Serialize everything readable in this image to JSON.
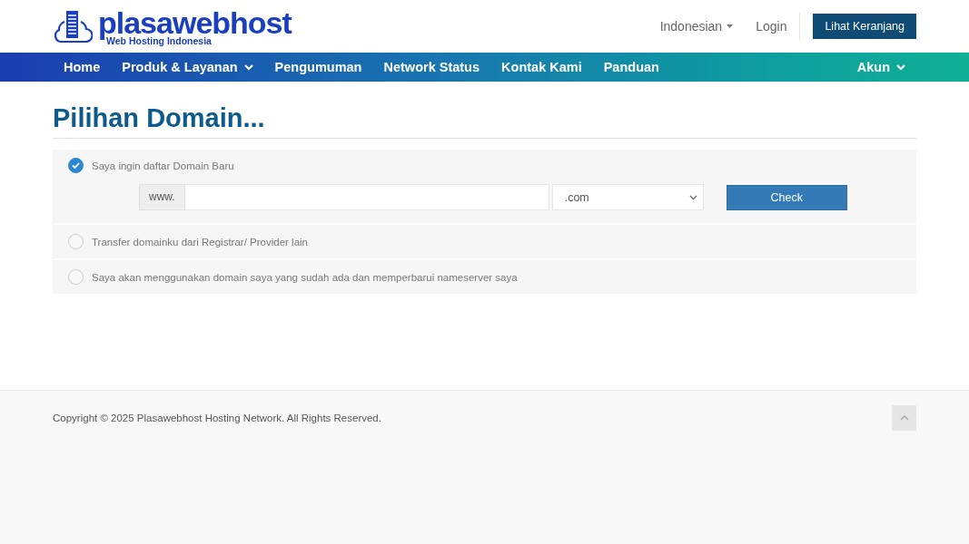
{
  "header": {
    "logo": {
      "name": "plasawebhost",
      "tagline": "Web Hosting Indonesia"
    },
    "language": "Indonesian",
    "login": "Login",
    "cart_button": "Lihat Keranjang"
  },
  "nav": {
    "items": [
      {
        "label": "Home",
        "has_menu": false
      },
      {
        "label": "Produk & Layanan",
        "has_menu": true
      },
      {
        "label": "Pengumuman",
        "has_menu": false
      },
      {
        "label": "Network Status",
        "has_menu": false
      },
      {
        "label": "Kontak Kami",
        "has_menu": false
      },
      {
        "label": "Panduan",
        "has_menu": false
      }
    ],
    "account": {
      "label": "Akun",
      "has_menu": true
    }
  },
  "page_title": "Pilihan Domain...",
  "domain_options": [
    {
      "label": "Saya ingin daftar Domain Baru",
      "selected": true
    },
    {
      "label": "Transfer domainku dari Registrar/ Provider lain",
      "selected": false
    },
    {
      "label": "Saya akan menggunakan domain saya yang sudah ada dan memperbarui nameserver saya",
      "selected": false
    }
  ],
  "domain_search": {
    "prefix": "www.",
    "tld": ".com",
    "button": "Check"
  },
  "footer": {
    "copyright": "Copyright © 2025 Plasawebhost Hosting Network. All Rights Reserved."
  }
}
